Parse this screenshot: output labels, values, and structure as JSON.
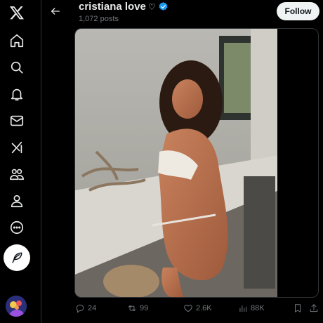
{
  "profile": {
    "name": "cristiana love",
    "name_emoji": "♡",
    "posts": "1,072 posts",
    "follow_label": "Follow"
  },
  "actions": {
    "replies": "24",
    "reposts": "99",
    "likes": "2.6K",
    "views": "88K"
  },
  "icons": {
    "logo": "x-logo-icon",
    "nav": [
      "home-icon",
      "search-icon",
      "notifications-icon",
      "messages-icon",
      "grok-icon",
      "communities-icon",
      "profile-icon",
      "more-icon"
    ],
    "compose": "compose-feather-icon",
    "back": "back-arrow-icon",
    "verified": "verified-badge-icon"
  },
  "colors": {
    "background": "#000000",
    "text": "#e7e9ea",
    "muted": "#71767b",
    "verified": "#1d9bf0",
    "follow_bg": "#eff3f4"
  }
}
